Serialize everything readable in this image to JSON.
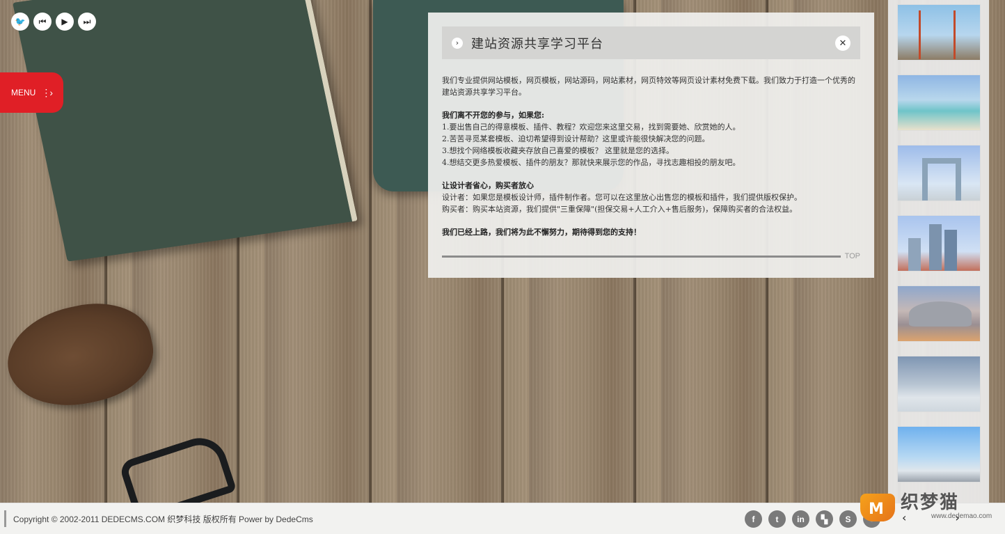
{
  "player": {
    "buttons": [
      {
        "icon": "bird-icon",
        "glyph": "🐦"
      },
      {
        "icon": "previous-icon",
        "glyph": "⏮"
      },
      {
        "icon": "play-icon",
        "glyph": "▶"
      },
      {
        "icon": "next-icon",
        "glyph": "⏭"
      }
    ]
  },
  "menu": {
    "label": "MENU",
    "arrow": "⋮›"
  },
  "panel": {
    "title": "建站资源共享学习平台",
    "intro": "我们专业提供网站模板，网页模板，网站源码，网站素材，网页特效等网页设计素材免费下载。我们致力于打造一个优秀的建站资源共享学习平台。",
    "section1_heading": "我们离不开您的参与，如果您:",
    "section1_items": [
      "1.要出售自己的得意模板、插件、教程？欢迎您来这里交易，找到需要她、欣赏她的人。",
      "2.苦苦寻觅某套模板、迫切希望得到设计帮助？这里或许能很快解决您的问题。",
      "3.想找个网络模板收藏夹存放自己喜爱的模板？ 这里就是您的选择。",
      "4.想结交更多热爱模板、插件的朋友？那就快来展示您的作品，寻找志趣相投的朋友吧。"
    ],
    "section2_heading": "让设计者省心，购买者放心",
    "section2_items": [
      "设计者：如果您是模板设计师，插件制作者。您可以在这里放心出售您的模板和插件，我们提供版权保护。",
      "购买者：购买本站资源，我们提供\"三重保障\"(担保交易+人工介入+售后服务)，保障购买者的合法权益。"
    ],
    "closing": "我们已经上路，我们将为此不懈努力，期待得到您的支持！",
    "top_label": "TOP",
    "close_glyph": "✕",
    "chevron_glyph": "›"
  },
  "thumbnails": [
    {
      "name": "golden-gate-bridge"
    },
    {
      "name": "beach-coast"
    },
    {
      "name": "cctv-tower"
    },
    {
      "name": "city-skyscrapers"
    },
    {
      "name": "national-grand-theater"
    },
    {
      "name": "person-above-clouds"
    },
    {
      "name": "snowy-shore"
    }
  ],
  "footer": {
    "copyright": "Copyright © 2002-2011 DEDECMS.COM 织梦科技 版权所有 Power by DedeCms",
    "social": [
      {
        "icon": "facebook-icon",
        "glyph": "f"
      },
      {
        "icon": "twitter-icon",
        "glyph": "t"
      },
      {
        "icon": "linkedin-icon",
        "glyph": "in"
      },
      {
        "icon": "delicious-icon",
        "glyph": "▚"
      },
      {
        "icon": "stumbleupon-icon",
        "glyph": "S"
      },
      {
        "icon": "rss-icon",
        "glyph": "◔"
      }
    ],
    "scroll_left": "‹",
    "scroll_right": "›"
  },
  "logo": {
    "name": "织梦猫",
    "url": "www.dedemao.com",
    "mark": "M"
  },
  "colors": {
    "menu": "#e01f26",
    "panel_bg": "#f0f0ee",
    "logo_orange": "#f6a21b"
  }
}
